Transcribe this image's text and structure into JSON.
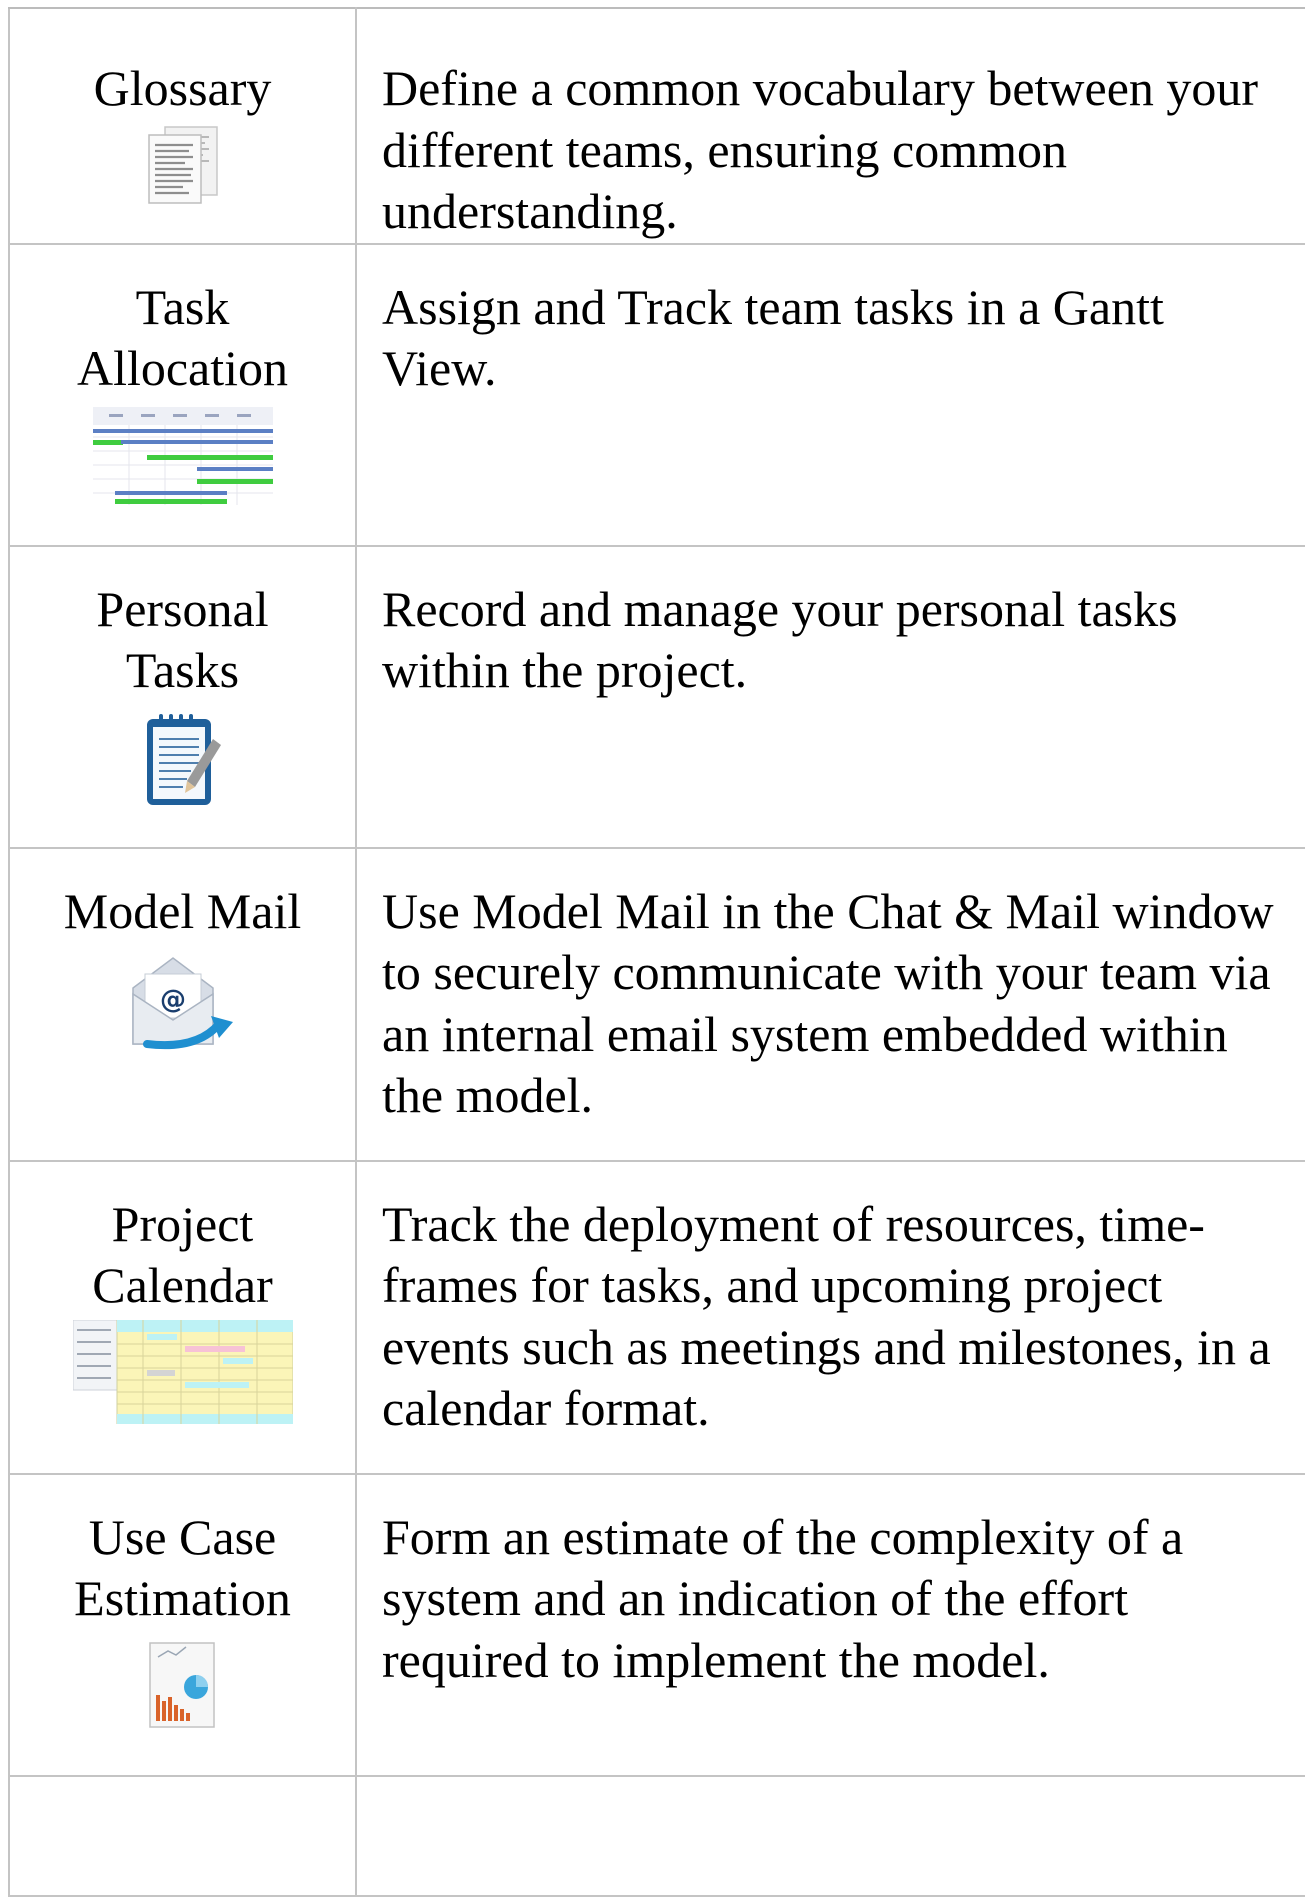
{
  "rows": [
    {
      "name": "Glossary",
      "icon": "glossary-document-icon",
      "description": "Define a common vocabulary between your different teams, ensuring common understanding."
    },
    {
      "name": "Task\nAllocation",
      "icon": "gantt-chart-icon",
      "description": "Assign and Track team tasks in a Gantt View."
    },
    {
      "name": "Personal\nTasks",
      "icon": "notepad-pencil-icon",
      "description": "Record and manage your personal tasks within the project."
    },
    {
      "name": "Model Mail",
      "icon": "mail-envelope-icon",
      "description": "Use Model Mail in the Chat & Mail window to securely communicate with your team via an internal email system embedded within the model."
    },
    {
      "name": "Project\nCalendar",
      "icon": "calendar-grid-icon",
      "description": "Track the deployment of resources, time-frames for tasks, and upcoming project events such as meetings and milestones, in a calendar format."
    },
    {
      "name": "Use Case\nEstimation",
      "icon": "estimation-chart-icon",
      "description": "Form an estimate of the complexity of a system and an indication of the effort required to implement the model."
    },
    {
      "name": "",
      "icon": "",
      "description": ""
    }
  ],
  "colors": {
    "border": "#c4c4c4",
    "gantt_green": "#3fcc3f",
    "gantt_blue": "#5b7fc4",
    "notepad_blue": "#1f5f9a",
    "mail_arrow": "#1f8fd0",
    "calendar_yellow": "#fbf5b8",
    "calendar_cyan": "#bdf2f5",
    "chart_orange": "#d9632a",
    "chart_blue": "#3aa6dc"
  }
}
